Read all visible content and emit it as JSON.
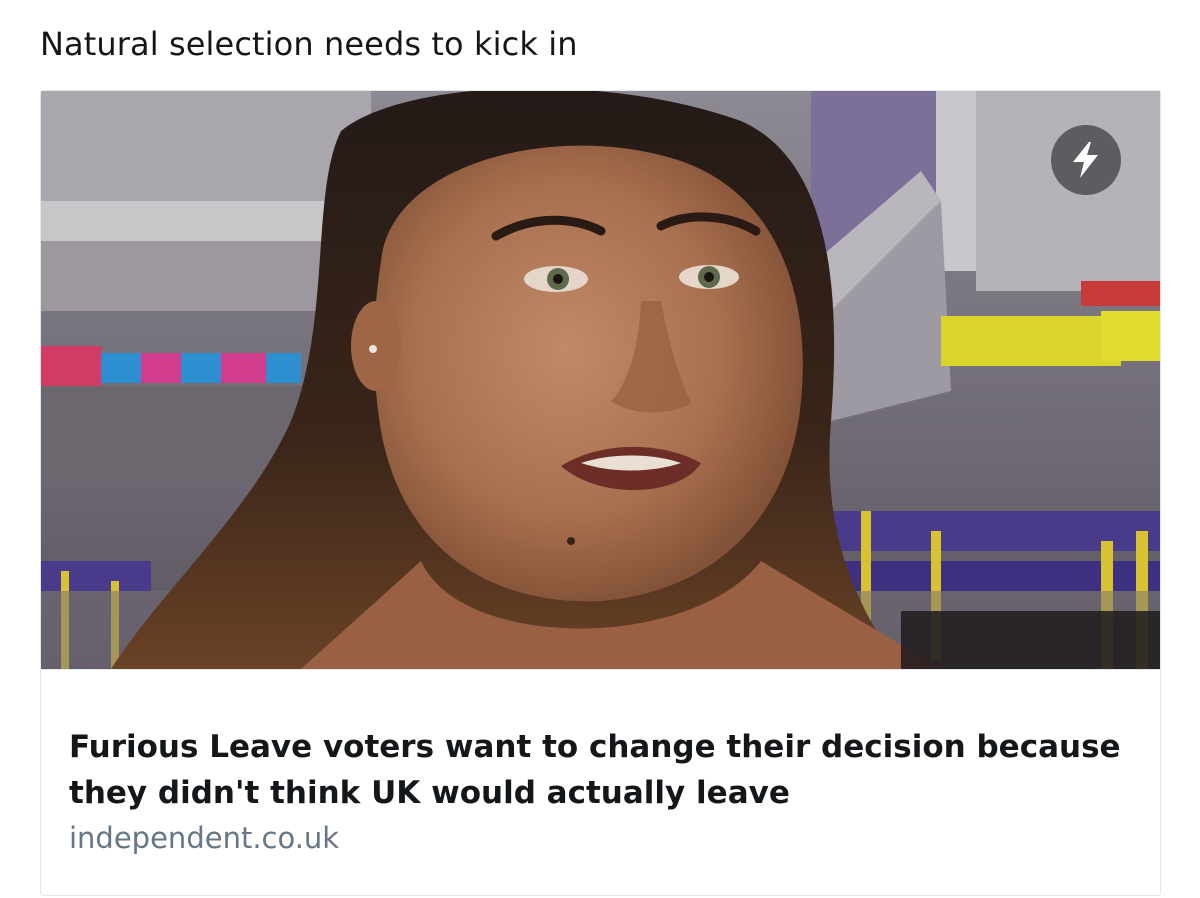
{
  "post": {
    "text": "Natural selection needs to kick in"
  },
  "card": {
    "title": "Furious Leave voters want to change their decision because they didn't think UK would actually leave",
    "domain": "independent.co.uk",
    "badge_icon": "lightning-bolt-icon"
  },
  "colors": {
    "text_primary": "#14171a",
    "text_secondary": "#657786",
    "card_border": "#e1e8ed"
  }
}
